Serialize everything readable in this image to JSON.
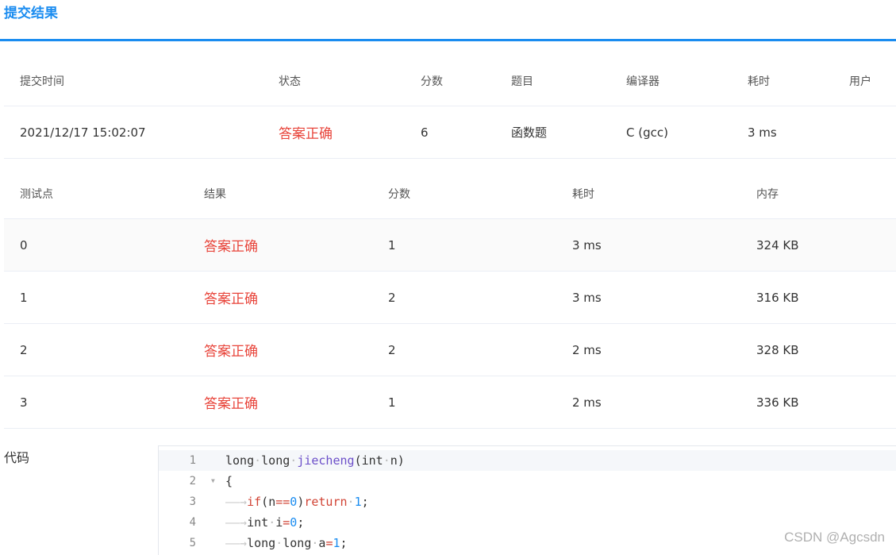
{
  "tab": {
    "title": "提交结果"
  },
  "summary": {
    "headers": [
      "提交时间",
      "状态",
      "分数",
      "题目",
      "编译器",
      "耗时",
      "用户"
    ],
    "row": {
      "time": "2021/12/17 15:02:07",
      "status": "答案正确",
      "score": "6",
      "problem": "函数题",
      "compiler": "C (gcc)",
      "elapsed": "3 ms",
      "user": ""
    }
  },
  "cases": {
    "headers": [
      "测试点",
      "结果",
      "分数",
      "耗时",
      "内存"
    ],
    "rows": [
      {
        "id": "0",
        "result": "答案正确",
        "score": "1",
        "time": "3 ms",
        "memory": "324 KB"
      },
      {
        "id": "1",
        "result": "答案正确",
        "score": "2",
        "time": "3 ms",
        "memory": "316 KB"
      },
      {
        "id": "2",
        "result": "答案正确",
        "score": "2",
        "time": "2 ms",
        "memory": "328 KB"
      },
      {
        "id": "3",
        "result": "答案正确",
        "score": "1",
        "time": "2 ms",
        "memory": "336 KB"
      }
    ]
  },
  "code": {
    "label": "代码",
    "line_numbers": [
      "1",
      "2",
      "3",
      "4",
      "5"
    ],
    "lines": [
      "long long jiecheng(int n)",
      "{",
      "    if(n==0)return 1;",
      "    int i=0;",
      "    long long a=1;"
    ]
  },
  "watermark": "CSDN @Agcsdn",
  "colors": {
    "accent": "#1a8cf0",
    "status_ok": "#e8443a",
    "keyword": "#d14334",
    "function": "#6c4fc9",
    "number": "#1a8cf0"
  },
  "icons": {
    "fold": "chevron-down-icon",
    "tab_arrow": "tab-arrow-icon"
  }
}
